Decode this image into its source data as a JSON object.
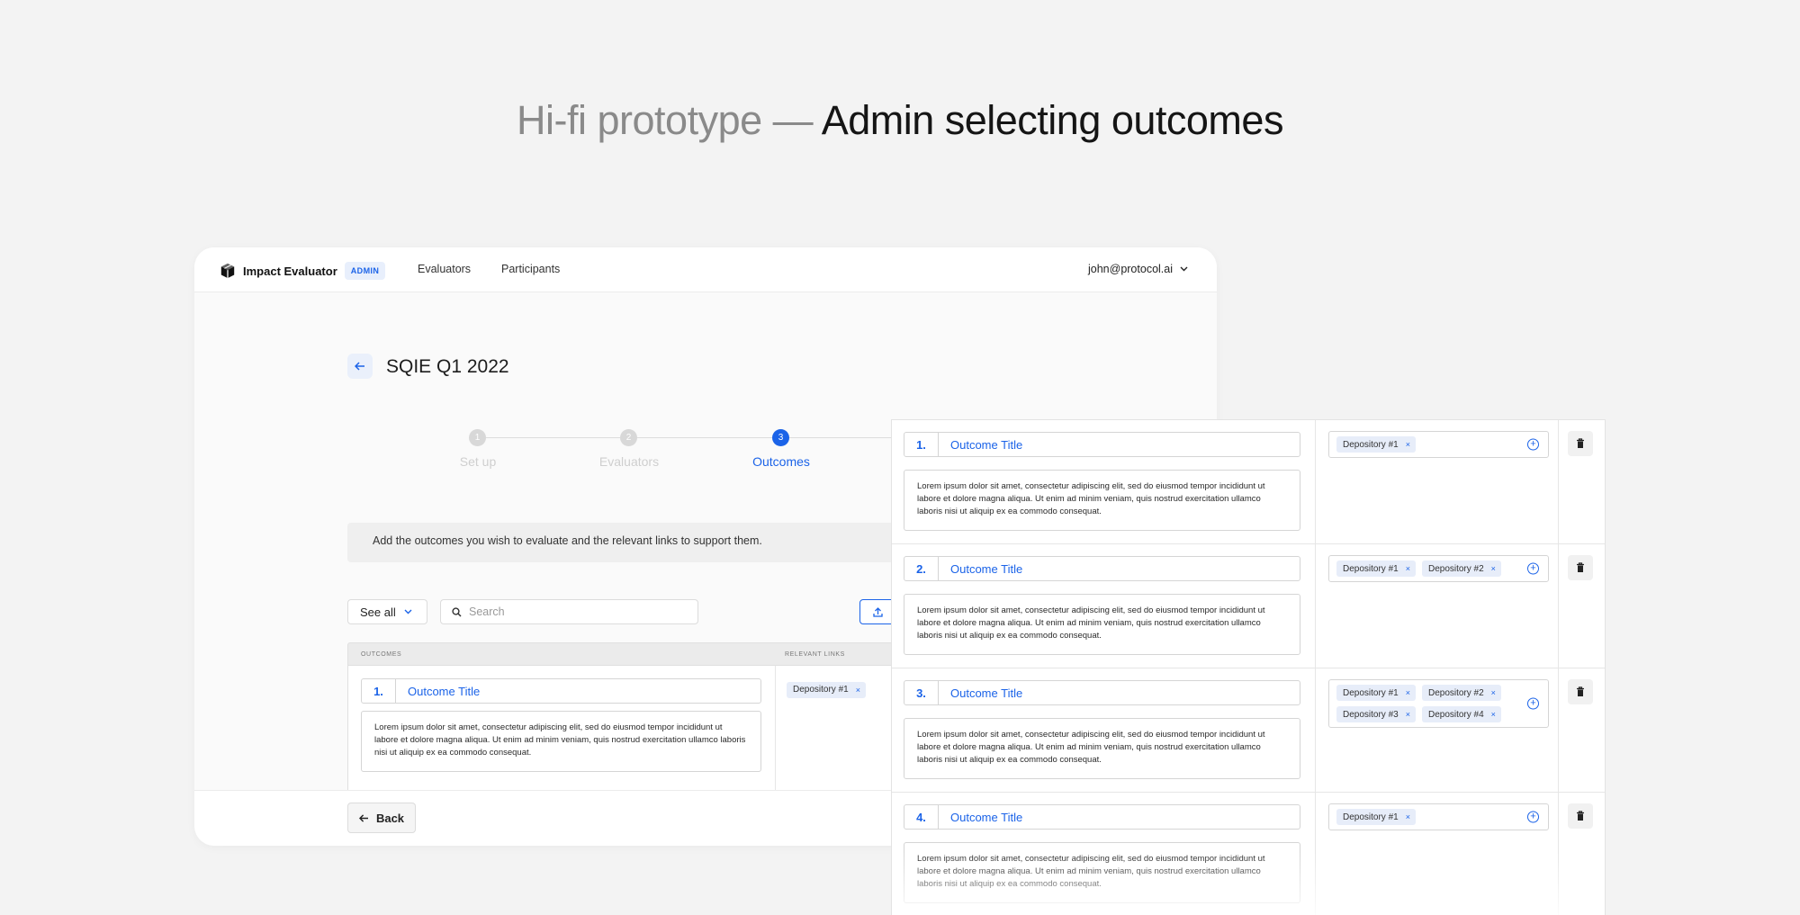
{
  "headline": {
    "prefix": "Hi-fi prototype —",
    "main": "Admin selecting outcomes"
  },
  "app": {
    "brand": "Impact Evaluator",
    "badge": "ADMIN",
    "nav": [
      "Evaluators",
      "Participants"
    ],
    "user": "john@protocol.ai",
    "page_title": "SQIE Q1 2022",
    "steps": [
      {
        "num": "1",
        "label": "Set up"
      },
      {
        "num": "2",
        "label": "Evaluators"
      },
      {
        "num": "3",
        "label": "Outcomes"
      }
    ],
    "info": "Add the outcomes you wish to evaluate and the relevant links to support them.",
    "filter": "See all",
    "search_placeholder": "Search",
    "table_headers": {
      "outcomes": "OUTCOMES",
      "links": "RELEVANT LINKS"
    },
    "back_label": "Back"
  },
  "lorem": "Lorem ipsum dolor sit amet, consectetur adipiscing elit, sed do eiusmod tempor incididunt ut labore et dolore magna aliqua. Ut enim ad minim veniam, quis nostrud exercitation ullamco laboris nisi ut aliquip ex ea commodo consequat.",
  "outcomes": [
    {
      "num": "1.",
      "title": "Outcome Title",
      "links": [
        "Depository #1"
      ]
    },
    {
      "num": "2.",
      "title": "Outcome Title",
      "links": [
        "Depository #1",
        "Depository #2"
      ]
    },
    {
      "num": "3.",
      "title": "Outcome Title",
      "links": [
        "Depository #1",
        "Depository #2",
        "Depository #3",
        "Depository #4"
      ]
    },
    {
      "num": "4.",
      "title": "Outcome Title",
      "links": [
        "Depository #1"
      ]
    }
  ],
  "tag_remove": "×",
  "colors": {
    "accent": "#1b63e8",
    "tag_bg": "#e7edf9",
    "background": "#f3f3f3"
  },
  "icons": [
    "logo-icon",
    "chevron-down-icon",
    "arrow-left-icon",
    "search-icon",
    "upload-icon",
    "plus-circle-icon",
    "trash-icon"
  ]
}
